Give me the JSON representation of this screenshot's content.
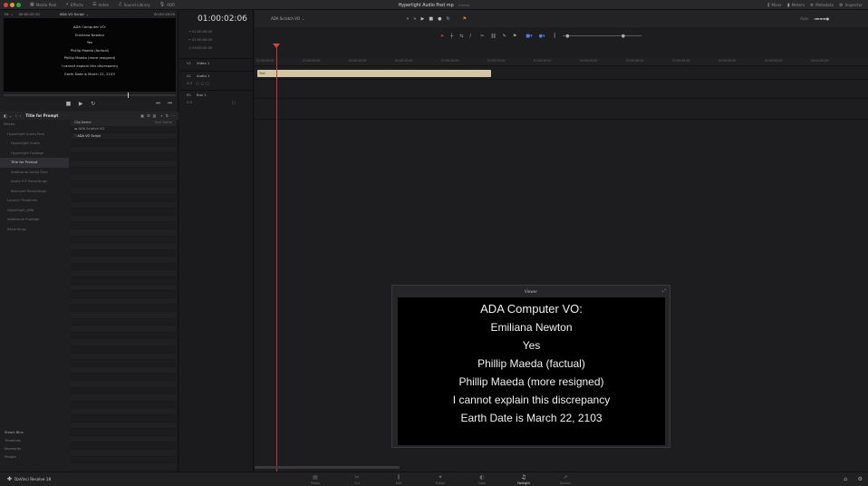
{
  "topbar": {
    "items": [
      {
        "icon": "media-pool-icon",
        "glyph": "▦",
        "label": "Media Pool"
      },
      {
        "icon": "effects-icon",
        "glyph": "⚡",
        "label": "Effects"
      },
      {
        "icon": "index-icon",
        "glyph": "☰",
        "label": "Index"
      },
      {
        "icon": "sound-library-icon",
        "glyph": "♫",
        "label": "Sound Library"
      },
      {
        "icon": "adr-icon",
        "glyph": "🎙",
        "label": "ADR"
      }
    ],
    "project_title": "Hyperlight Audio Post mp",
    "edited": "Edited",
    "right_items": [
      {
        "icon": "mixer-icon",
        "glyph": "⫼",
        "label": "Mixer"
      },
      {
        "icon": "meters-icon",
        "glyph": "▮",
        "label": "Meters"
      },
      {
        "icon": "metadata-icon",
        "glyph": "≡",
        "label": "Metadata"
      },
      {
        "icon": "inspector-icon",
        "glyph": "⚙",
        "label": "Inspector"
      }
    ]
  },
  "source": {
    "zoom": "Fit",
    "timecode_in": "00:00:25:10",
    "clip_name": "ADA VO Script",
    "timecode_dur": "00:00:18:20"
  },
  "preview_lines": [
    "ADA Computer VO:",
    "Emiliana Newton",
    "Yes",
    "Phillip Maeda (factual)",
    "Phillip Maeda (more resigned)",
    "I cannot explain this discrepancy",
    "Earth Date is March 22, 2103"
  ],
  "bin_bar": {
    "title": "Title for Prompt"
  },
  "bins": [
    {
      "label": "Master",
      "selected": false
    },
    {
      "label": "Hyperlight Audio Post",
      "selected": false
    },
    {
      "label": "Hyperlight Audio",
      "selected": false
    },
    {
      "label": "Hyperlight Footage",
      "selected": false
    },
    {
      "label": "Title for Prompt",
      "selected": true
    },
    {
      "label": "Additional Audio Files",
      "selected": false
    },
    {
      "label": "Audio ICF Recordings",
      "selected": false
    },
    {
      "label": "Bounced Recordings",
      "selected": false
    },
    {
      "label": "Launch Timelines",
      "selected": false
    },
    {
      "label": "Hyperlight_ARA",
      "selected": false
    },
    {
      "label": "Additional Footage",
      "selected": false
    },
    {
      "label": "Recordings",
      "selected": false
    }
  ],
  "smart_bins": {
    "title": "Smart Bins",
    "items": [
      "Timelines",
      "Keywords",
      "People"
    ]
  },
  "clip_list": {
    "col_name": "Clip Name",
    "col_reel": "Reel Name",
    "rows": [
      "ADA Scratch VO",
      "ADA VO Script"
    ]
  },
  "timeline": {
    "timecode": "01:00:02:06",
    "name": "ADA Scratch VO",
    "tc_lines": [
      "01:00:00:00",
      "01:00:00:00",
      "00:00:00:00"
    ],
    "ruler_ticks": [
      "01:00:00:00",
      "01:00:05:00",
      "01:00:10:00",
      "01:00:15:00",
      "01:00:20:00",
      "01:00:25:00",
      "01:00:30:00",
      "01:00:35:00",
      "01:00:40:00",
      "01:00:45:00",
      "01:00:50:00",
      "01:00:55:00",
      "01:01:00:00"
    ],
    "tracks": [
      {
        "id": "V1",
        "name": "Video 1"
      },
      {
        "id": "A1",
        "name": "Audio 1",
        "level": "0.0"
      },
      {
        "id": "B1",
        "name": "Bus 1",
        "level": "0.0"
      }
    ],
    "clip_label": "Text",
    "bus_label": "Bus 1",
    "output": "Auto"
  },
  "viewer": {
    "title": "Viewer",
    "lines": [
      "ADA Computer VO:",
      "Emiliana Newton",
      "Yes",
      "Phillip Maeda (factual)",
      "Phillip Maeda (more resigned)",
      "I cannot explain this discrepancy",
      "Earth Date is March 22, 2103"
    ]
  },
  "bottom": {
    "app_name": "DaVinci Resolve 18",
    "pages": [
      {
        "icon": "media-page-icon",
        "glyph": "▤",
        "label": "Media",
        "active": false
      },
      {
        "icon": "cut-page-icon",
        "glyph": "✂",
        "label": "Cut",
        "active": false
      },
      {
        "icon": "edit-page-icon",
        "glyph": "⫼",
        "label": "Edit",
        "active": false
      },
      {
        "icon": "fusion-page-icon",
        "glyph": "✦",
        "label": "Fusion",
        "active": false
      },
      {
        "icon": "color-page-icon",
        "glyph": "◐",
        "label": "Color",
        "active": false
      },
      {
        "icon": "fairlight-page-icon",
        "glyph": "♫",
        "label": "Fairlight",
        "active": true
      },
      {
        "icon": "deliver-page-icon",
        "glyph": "➚",
        "label": "Deliver",
        "active": false
      }
    ]
  },
  "colors": {
    "playhead": "#c53a2e",
    "clip": "#d3c6a5",
    "selected_bin": "#2f2f33"
  }
}
